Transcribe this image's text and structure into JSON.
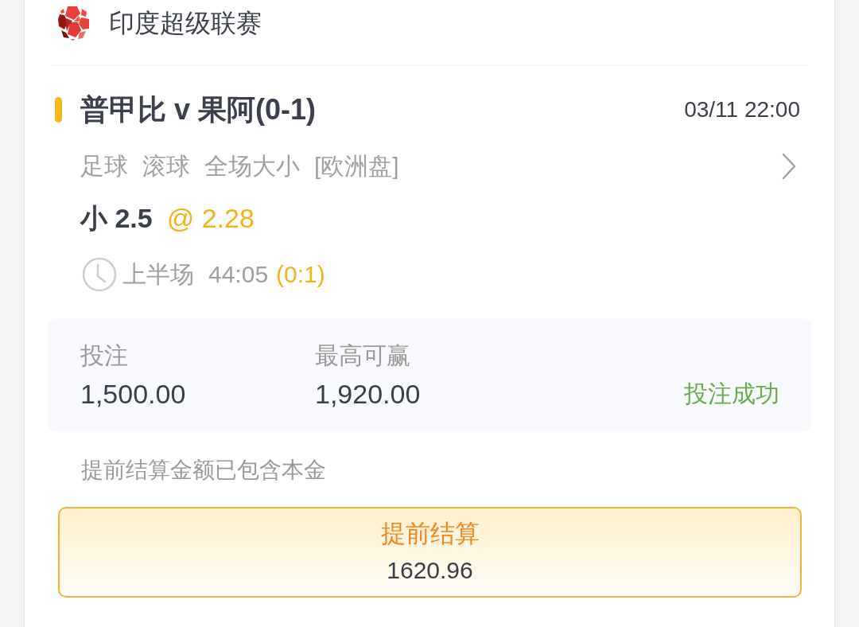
{
  "league": {
    "name": "印度超级联赛"
  },
  "bet": {
    "match": "普甲比 v 果阿(0-1)",
    "time": "03/11 22:00",
    "tags": [
      "足球",
      "滚球",
      "全场大小",
      "[欧洲盘]"
    ],
    "selection": "小 2.5",
    "odds": "@ 2.28",
    "period": "上半场",
    "clock": "44:05",
    "score": "(0:1)"
  },
  "summary": {
    "fields": [
      {
        "label": "投注",
        "value": "1,500.00"
      },
      {
        "label": "最高可赢",
        "value": "1,920.00"
      }
    ],
    "status": {
      "text": "投注成功",
      "kind": "success"
    }
  },
  "note": "提前结算金额已包含本金",
  "cashout": {
    "label": "提前结算",
    "amount": "1620.96"
  }
}
